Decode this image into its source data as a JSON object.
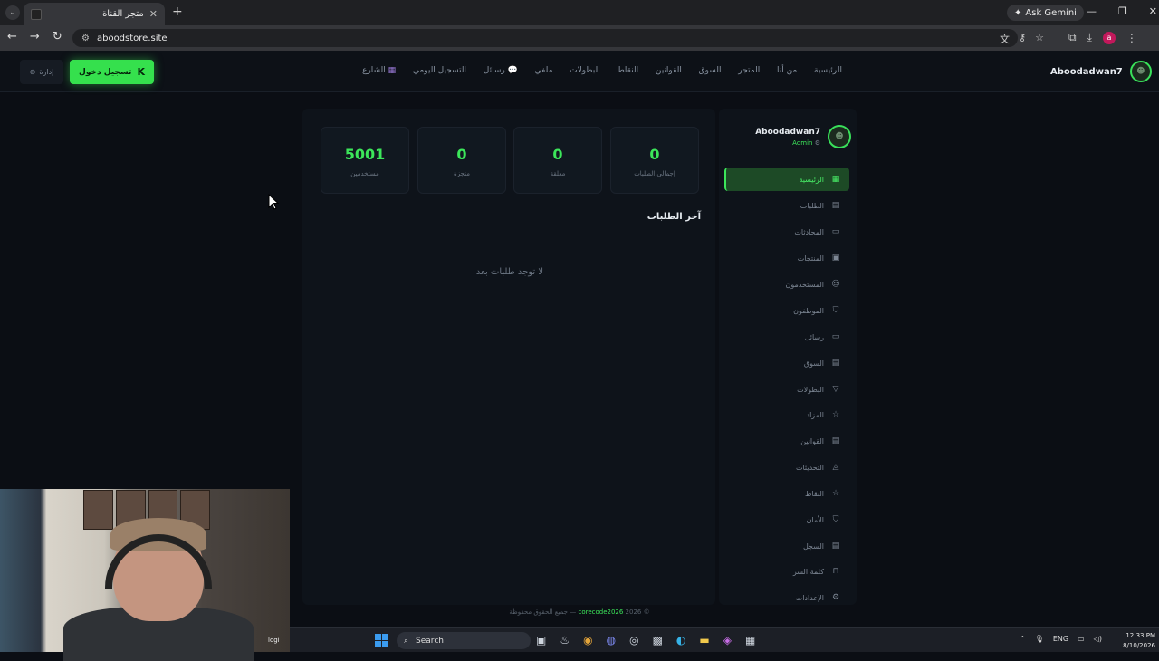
{
  "browser": {
    "tab_title": "متجر القناة",
    "url": "aboodstore.site",
    "gemini_label": "Ask Gemini",
    "profile_initial": "a"
  },
  "site": {
    "brand_name": "Aboodadwan7",
    "nav": [
      "الرئيسية",
      "من أنا",
      "المتجر",
      "السوق",
      "القوانين",
      "النقاط",
      "البطولات",
      "ملفي",
      "رسائل",
      "التسجيل اليومي",
      "الشارع"
    ],
    "login_label": "تسجيل دخول",
    "login_key": "K",
    "admin_label": "إدارة"
  },
  "dashboard": {
    "stats": [
      {
        "value": "0",
        "label": "إجمالي الطلبات"
      },
      {
        "value": "0",
        "label": "معلقة"
      },
      {
        "value": "0",
        "label": "منجزة"
      },
      {
        "value": "5001",
        "label": "مستخدمين"
      }
    ],
    "recent_title": "آخر الطلبات",
    "empty_text": "لا توجد طلبات بعد"
  },
  "sidebar": {
    "user_name": "Aboodadwan7",
    "user_role": "Admin",
    "items": [
      {
        "label": "الرئيسية",
        "icon": "▦"
      },
      {
        "label": "الطلبات",
        "icon": "▤"
      },
      {
        "label": "المحادثات",
        "icon": "▭"
      },
      {
        "label": "المنتجات",
        "icon": "▣"
      },
      {
        "label": "المستخدمون",
        "icon": "☺"
      },
      {
        "label": "الموظفون",
        "icon": "⛉"
      },
      {
        "label": "رسائل",
        "icon": "▭"
      },
      {
        "label": "السوق",
        "icon": "▤"
      },
      {
        "label": "البطولات",
        "icon": "▽"
      },
      {
        "label": "المزاد",
        "icon": "☆"
      },
      {
        "label": "القوانين",
        "icon": "▤"
      },
      {
        "label": "التحديثات",
        "icon": "◬"
      },
      {
        "label": "النقاط",
        "icon": "☆"
      },
      {
        "label": "الأمان",
        "icon": "⛉"
      },
      {
        "label": "السجل",
        "icon": "▤"
      },
      {
        "label": "كلمة السر",
        "icon": "⊓"
      },
      {
        "label": "الإعدادات",
        "icon": "⚙"
      }
    ]
  },
  "footer": {
    "text": "جميع الحقوق محفوظة — ",
    "brand": "corecode2026",
    "year": " 2026 ©"
  },
  "webcam": {
    "label": "logi"
  },
  "taskbar": {
    "search_label": "Search",
    "lang": "ENG",
    "time": "12:33 PM",
    "date": "8/10/2026"
  }
}
